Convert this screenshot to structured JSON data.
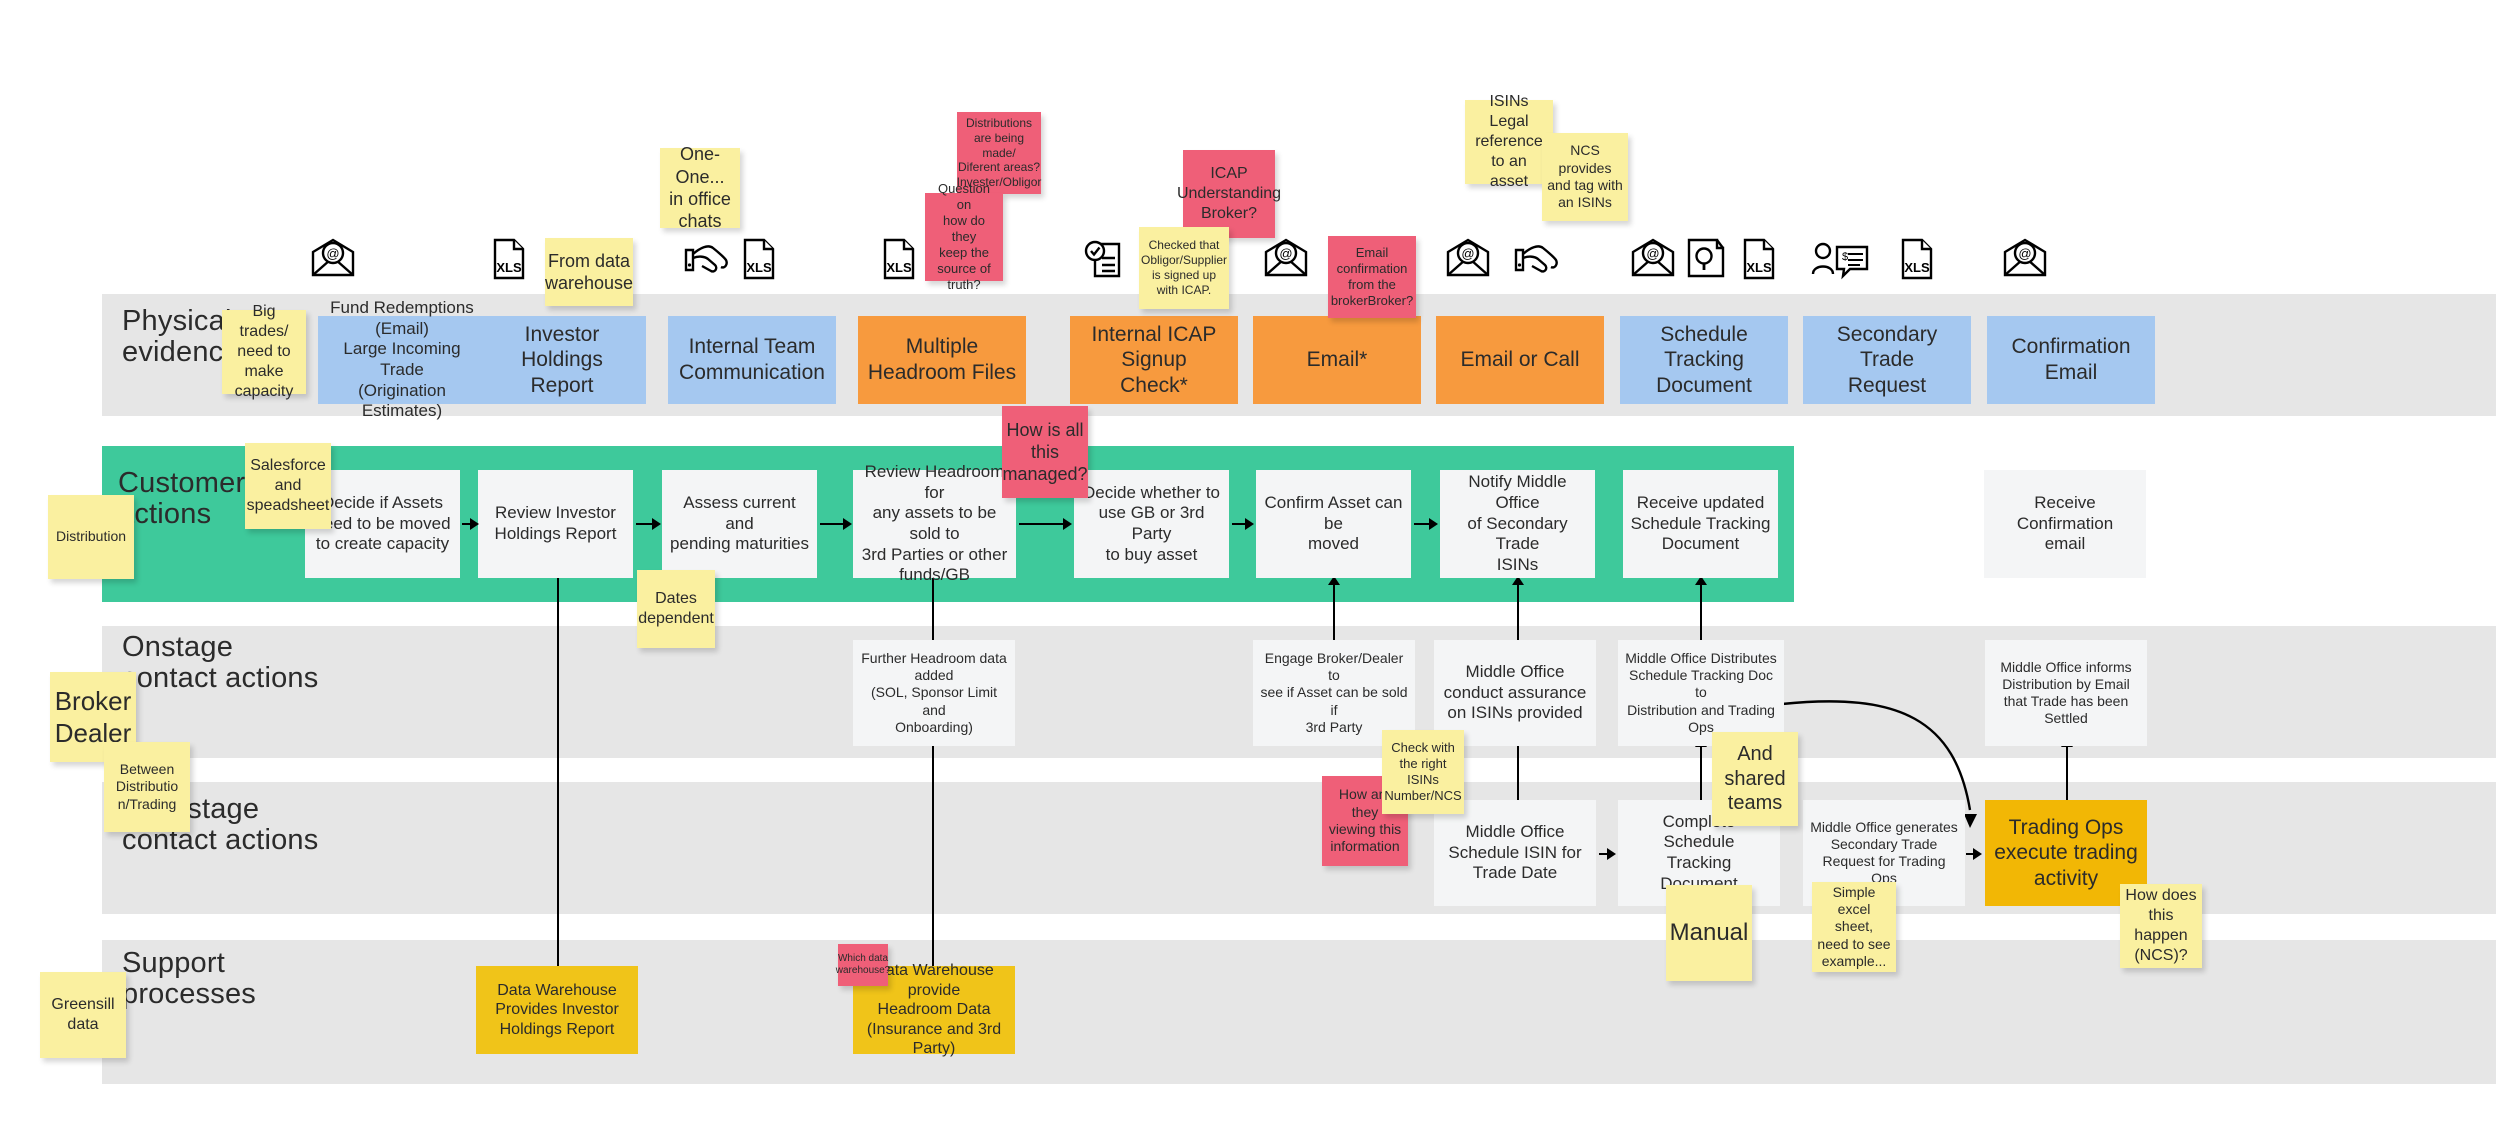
{
  "lanes": [
    {
      "id": "physical-evidence",
      "title": "Physical\nevidence"
    },
    {
      "id": "customer-actions",
      "title": "Customer\nactions"
    },
    {
      "id": "onstage-contact-actions",
      "title": "Onstage\ncontact actions"
    },
    {
      "id": "backstage-contact-actions",
      "title": "Backstage\ncontact actions"
    },
    {
      "id": "support-processes",
      "title": "Support\nprocesses"
    }
  ],
  "physical_evidence": [
    {
      "label": "Fund Redemptions\n(Email)\nLarge Incoming Trade\n(Origination Estimates)",
      "color": "#a5c8f0"
    },
    {
      "label": "Investor Holdings\nReport",
      "color": "#a5c8f0"
    },
    {
      "label": "Internal Team\nCommunication",
      "color": "#a5c8f0"
    },
    {
      "label": "Multiple\nHeadroom Files",
      "color": "#f79a3e"
    },
    {
      "label": "Internal ICAP Signup\nCheck*",
      "color": "#f79a3e"
    },
    {
      "label": "Email*",
      "color": "#f79a3e"
    },
    {
      "label": "Email or Call",
      "color": "#f79a3e"
    },
    {
      "label": "Schedule Tracking\nDocument",
      "color": "#a5c8f0"
    },
    {
      "label": "Secondary Trade\nRequest",
      "color": "#a5c8f0"
    },
    {
      "label": "Confirmation\nEmail",
      "color": "#a5c8f0"
    }
  ],
  "customer_actions": [
    {
      "label": "Decide if Assets\nneed to be moved\nto create capacity"
    },
    {
      "label": "Review Investor\nHoldings Report"
    },
    {
      "label": "Assess current and\npending maturities"
    },
    {
      "label": "Review Headroom for\nany assets to be sold to\n3rd Parties or other\nfunds/GB"
    },
    {
      "label": "Decide whether to\nuse GB or 3rd Party\nto buy asset"
    },
    {
      "label": "Confirm Asset can be\nmoved"
    },
    {
      "label": "Notify Middle Office\nof Secondary Trade\nISINs"
    },
    {
      "label": "Receive updated\nSchedule Tracking\nDocument"
    },
    {
      "label": "Receive Confirmation\nemail"
    }
  ],
  "onstage_actions": [
    {
      "label": "Further Headroom data\nadded\n(SOL, Sponsor Limit and\nOnboarding)"
    },
    {
      "label": "Engage Broker/Dealer to\nsee if Asset can be sold if\n3rd Party"
    },
    {
      "label": "Middle Office\nconduct assurance\non ISINs provided"
    },
    {
      "label": "Middle Office Distributes\nSchedule Tracking Doc to\nDistribution and Trading\nOps"
    },
    {
      "label": "Middle Office informs\nDistribution by Email\nthat Trade has been\nSettled"
    }
  ],
  "backstage_actions": [
    {
      "label": "Middle Office\nSchedule ISIN for\nTrade Date",
      "color": "#f4f5f6"
    },
    {
      "label": "Complete Schedule\nTracking\nDocument",
      "color": "#f4f5f6"
    },
    {
      "label": "Middle Office generates\nSecondary Trade\nRequest for Trading Ops",
      "color": "#f4f5f6"
    },
    {
      "label": "Trading Ops\nexecute trading\nactivity",
      "color": "#f2b705"
    }
  ],
  "support_processes": [
    {
      "label": "Data Warehouse\nProvides Investor\nHoldings Report",
      "color": "#f0c419"
    },
    {
      "label": "Data Warehouse provide\nHeadroom Data\n(Insurance and 3rd Party)",
      "color": "#f0c419"
    }
  ],
  "sticky_notes": [
    {
      "id": "one-one-office-chats",
      "text": "One-One...\nin office\nchats",
      "color": "yellow"
    },
    {
      "id": "distributions-being-made",
      "text": "Distributions\nare being made/\nDiferent areas?\nInvester/Obligor",
      "color": "pink"
    },
    {
      "id": "question-source-of-truth",
      "text": "Question on\nhow do they\nkeep the\nsource of\ntruth?",
      "color": "pink"
    },
    {
      "id": "icap-understanding-broker",
      "text": "ICAP\nUnderstanding\nBroker?",
      "color": "pink"
    },
    {
      "id": "checked-obligor-signed-up",
      "text": "Checked that\nObligor/Supplier\nis signed up\nwith ICAP.",
      "color": "yellow"
    },
    {
      "id": "email-confirmation-broker",
      "text": "Email\nconfirmation\nfrom the\nbrokerBroker?",
      "color": "pink"
    },
    {
      "id": "isins-legal-reference",
      "text": "ISINs Legal\nreference\nto an asset",
      "color": "yellow"
    },
    {
      "id": "ncs-provides-tag-isins",
      "text": "NCS\nprovides\nand tag with\nan ISINs",
      "color": "yellow"
    },
    {
      "id": "from-data-warehouse",
      "text": "From data\nwarehouse",
      "color": "yellow"
    },
    {
      "id": "big-trades-capacity",
      "text": "Big trades/\nneed to\nmake\ncapacity",
      "color": "yellow"
    },
    {
      "id": "how-is-all-this-managed",
      "text": "How is all\nthis\nmanaged?",
      "color": "pink"
    },
    {
      "id": "salesforce-and-spreadsheet",
      "text": "Salesforce\nand\nspeadsheet",
      "color": "yellow"
    },
    {
      "id": "distribution",
      "text": "Distribution",
      "color": "yellow"
    },
    {
      "id": "dates-dependent",
      "text": "Dates\ndependent",
      "color": "yellow"
    },
    {
      "id": "broker-dealer",
      "text": "Broker\nDealer",
      "color": "yellow"
    },
    {
      "id": "between-distribution-trading",
      "text": "Between\nDistributio\nn/Trading",
      "color": "yellow"
    },
    {
      "id": "how-are-they-viewing",
      "text": "How are\nthey\nviewing this\ninformation",
      "color": "pink"
    },
    {
      "id": "check-with-right-isins",
      "text": "Check with\nthe right\nISINs\nNumber/NCS",
      "color": "yellow"
    },
    {
      "id": "and-shared-teams",
      "text": "And\nshared\nteams",
      "color": "yellow"
    },
    {
      "id": "manual",
      "text": "Manual",
      "color": "yellow"
    },
    {
      "id": "simple-excel-sheet",
      "text": "Simple\nexcel sheet,\nneed to see\nexample...",
      "color": "yellow"
    },
    {
      "id": "how-does-this-happen-ncs",
      "text": "How does\nthis happen\n(NCS)?",
      "color": "yellow"
    },
    {
      "id": "greensill-data",
      "text": "Greensill\ndata",
      "color": "yellow"
    },
    {
      "id": "which-data-warehouse",
      "text": "Which data\nwarehouse?",
      "color": "pink"
    }
  ],
  "icons": [
    {
      "id": "email-at-icon-1",
      "kind": "email-at"
    },
    {
      "id": "xls-file-icon-1",
      "kind": "xls"
    },
    {
      "id": "handshake-icon-1",
      "kind": "handshake"
    },
    {
      "id": "xls-file-icon-2",
      "kind": "xls"
    },
    {
      "id": "xls-file-icon-3",
      "kind": "xls"
    },
    {
      "id": "checklist-doc-icon-1",
      "kind": "checklist-doc"
    },
    {
      "id": "email-at-icon-2",
      "kind": "email-at"
    },
    {
      "id": "email-at-icon-3",
      "kind": "email-at"
    },
    {
      "id": "handshake-icon-2",
      "kind": "handshake"
    },
    {
      "id": "email-at-icon-4",
      "kind": "email-at"
    },
    {
      "id": "magnify-doc-icon-1",
      "kind": "magnify-doc"
    },
    {
      "id": "xls-file-icon-4",
      "kind": "xls"
    },
    {
      "id": "person-chat-icon-1",
      "kind": "person-chat"
    },
    {
      "id": "xls-file-icon-5",
      "kind": "xls"
    },
    {
      "id": "email-at-icon-5",
      "kind": "email-at"
    }
  ],
  "colors": {
    "lane_grey": "#e6e6e6",
    "lane_green": "#3ec99b",
    "evidence_blue": "#a5c8f0",
    "evidence_orange": "#f79a3e",
    "action_white": "#f4f5f6",
    "support_gold": "#f0c419",
    "trading_amber": "#f2b705",
    "sticky_yellow": "#faf0a0",
    "sticky_pink": "#ef5f78"
  }
}
